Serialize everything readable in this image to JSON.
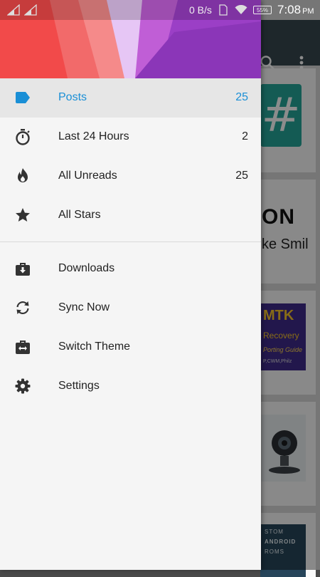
{
  "status_bar": {
    "net_speed": "0 B/s",
    "battery": "55%",
    "time": "7:08",
    "ampm": "PM"
  },
  "drawer": {
    "accent_color": "#1a8fd6",
    "primary_items": [
      {
        "label": "Posts",
        "count": "25",
        "icon": "label-tag-icon",
        "selected": true
      },
      {
        "label": "Last 24 Hours",
        "count": "2",
        "icon": "stopwatch-icon",
        "selected": false
      },
      {
        "label": "All Unreads",
        "count": "25",
        "icon": "flame-icon",
        "selected": false
      },
      {
        "label": "All Stars",
        "count": "",
        "icon": "star-icon",
        "selected": false
      }
    ],
    "secondary_items": [
      {
        "label": "Downloads",
        "icon": "download-briefcase-icon"
      },
      {
        "label": "Sync Now",
        "icon": "sync-icon"
      },
      {
        "label": "Switch Theme",
        "icon": "switch-theme-icon"
      },
      {
        "label": "Settings",
        "icon": "gear-icon"
      }
    ]
  },
  "background_app": {
    "card1_glyph": "#",
    "card2_title": "ON",
    "card2_subtitle": "ke Smil",
    "card3_lines": [
      "MTK",
      "Recovery",
      "Porting Guide",
      "P,CWM,Philz"
    ],
    "card5_lines": [
      "STOM",
      "ANDROID",
      "ROMS"
    ]
  }
}
